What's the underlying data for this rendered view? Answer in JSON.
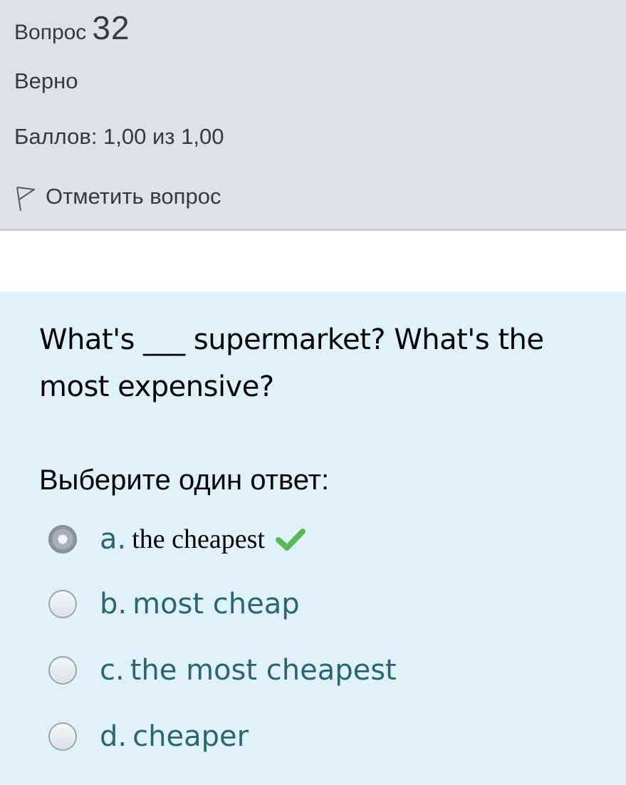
{
  "info": {
    "question_label": "Вопрос",
    "question_number": "32",
    "state": "Верно",
    "grade": "Баллов: 1,00 из 1,00",
    "flag_label": "Отметить вопрос"
  },
  "question": {
    "text": "What's ___ supermarket? What's the most expensive?",
    "prompt": "Выберите один ответ:"
  },
  "options": [
    {
      "letter": "a.",
      "text": "the cheapest",
      "selected": true,
      "correct": true
    },
    {
      "letter": "b.",
      "text": "most cheap",
      "selected": false
    },
    {
      "letter": "c.",
      "text": "the most cheapest",
      "selected": false
    },
    {
      "letter": "d.",
      "text": "cheaper",
      "selected": false
    }
  ],
  "icons": {
    "flag": "flag-icon",
    "correct": "check-icon"
  },
  "colors": {
    "info_bg": "#dee2e6",
    "content_bg": "#def2f8",
    "content_text": "#2d6473",
    "correct": "#5cb85c"
  }
}
